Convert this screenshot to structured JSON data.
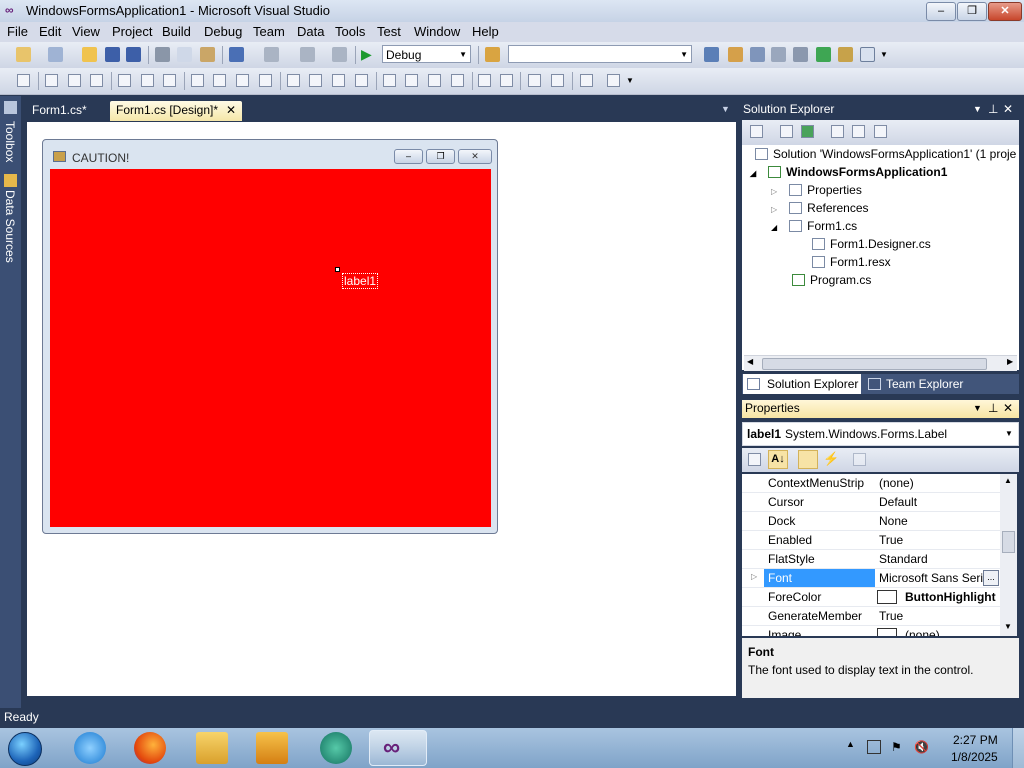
{
  "window": {
    "title": "WindowsFormsApplication1 - Microsoft Visual Studio"
  },
  "menu": [
    "File",
    "Edit",
    "View",
    "Project",
    "Build",
    "Debug",
    "Team",
    "Data",
    "Tools",
    "Test",
    "Window",
    "Help"
  ],
  "toolbar": {
    "config": "Debug",
    "find": ""
  },
  "side_strip": {
    "toolbox": "Toolbox",
    "data_sources": "Data Sources"
  },
  "tabs": [
    {
      "label": "Form1.cs*"
    },
    {
      "label": "Form1.cs [Design]*",
      "close": "✕"
    }
  ],
  "form": {
    "title": "CAUTION!",
    "label_text": "label1",
    "client_color": "#ff0000"
  },
  "solution_explorer": {
    "title": "Solution Explorer",
    "items": [
      {
        "label": "Solution 'WindowsFormsApplication1' (1 proje"
      },
      {
        "label": "WindowsFormsApplication1"
      },
      {
        "label": "Properties"
      },
      {
        "label": "References"
      },
      {
        "label": "Form1.cs"
      },
      {
        "label": "Form1.Designer.cs"
      },
      {
        "label": "Form1.resx"
      },
      {
        "label": "Program.cs"
      }
    ],
    "bottom_tabs": [
      "Solution Explorer",
      "Team Explorer"
    ]
  },
  "properties": {
    "title": "Properties",
    "object": "label1",
    "object_type": "System.Windows.Forms.Label",
    "rows": [
      {
        "name": "ContextMenuStrip",
        "value": "(none)"
      },
      {
        "name": "Cursor",
        "value": "Default"
      },
      {
        "name": "Dock",
        "value": "None"
      },
      {
        "name": "Enabled",
        "value": "True"
      },
      {
        "name": "FlatStyle",
        "value": "Standard"
      },
      {
        "name": "Font",
        "value": "Microsoft Sans Serif"
      },
      {
        "name": "ForeColor",
        "value": "ButtonHighlight"
      },
      {
        "name": "GenerateMember",
        "value": "True"
      },
      {
        "name": "Image",
        "value": "(none)"
      }
    ],
    "ellipsis": "...",
    "desc_title": "Font",
    "desc_text": "The font used to display text in the control."
  },
  "status": {
    "text": "Ready"
  },
  "taskbar": {
    "time": "2:27 PM",
    "date": "1/8/2025"
  },
  "colors": {
    "accent": "#3399ff",
    "chrome": "#293955",
    "selection": "#3399ff"
  }
}
